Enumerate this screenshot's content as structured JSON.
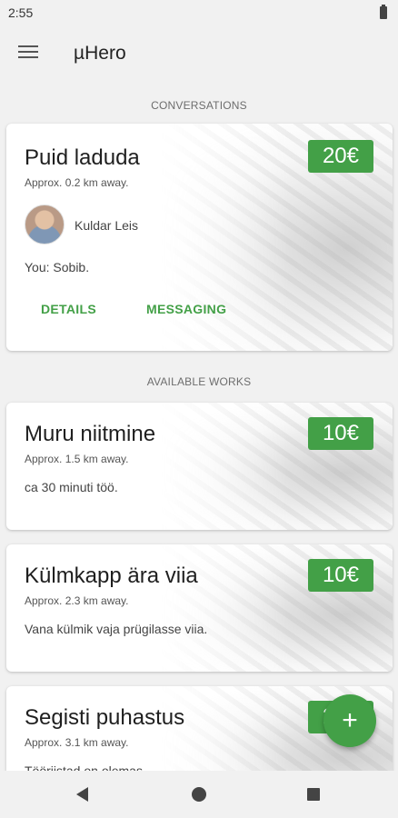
{
  "status_bar": {
    "time": "2:55"
  },
  "app_bar": {
    "title": "µHero",
    "menu_icon": "hamburger-menu-icon"
  },
  "sections": {
    "conversations": "CONVERSATIONS",
    "available_works": "AVAILABLE WORKS"
  },
  "conversation": {
    "title": "Puid laduda",
    "distance": "Approx. 0.2 km away.",
    "price": "20€",
    "person_name": "Kuldar Leis",
    "last_message": "You: Sobib.",
    "details_label": "DETAILS",
    "messaging_label": "MESSAGING"
  },
  "works": [
    {
      "title": "Muru niitmine",
      "distance": "Approx. 1.5 km away.",
      "description": "ca 30 minuti töö.",
      "price": "10€"
    },
    {
      "title": "Külmkapp ära viia",
      "distance": "Approx. 2.3 km away.",
      "description": "Vana külmik vaja prügilasse viia.",
      "price": "10€"
    },
    {
      "title": "Segisti puhastus",
      "distance": "Approx. 3.1 km away.",
      "description": "Tööriistad on olemas.",
      "price": "20€"
    }
  ],
  "fab": {
    "label": "+",
    "icon": "add-icon"
  },
  "colors": {
    "accent": "#43a047",
    "background": "#f1f1f1"
  }
}
